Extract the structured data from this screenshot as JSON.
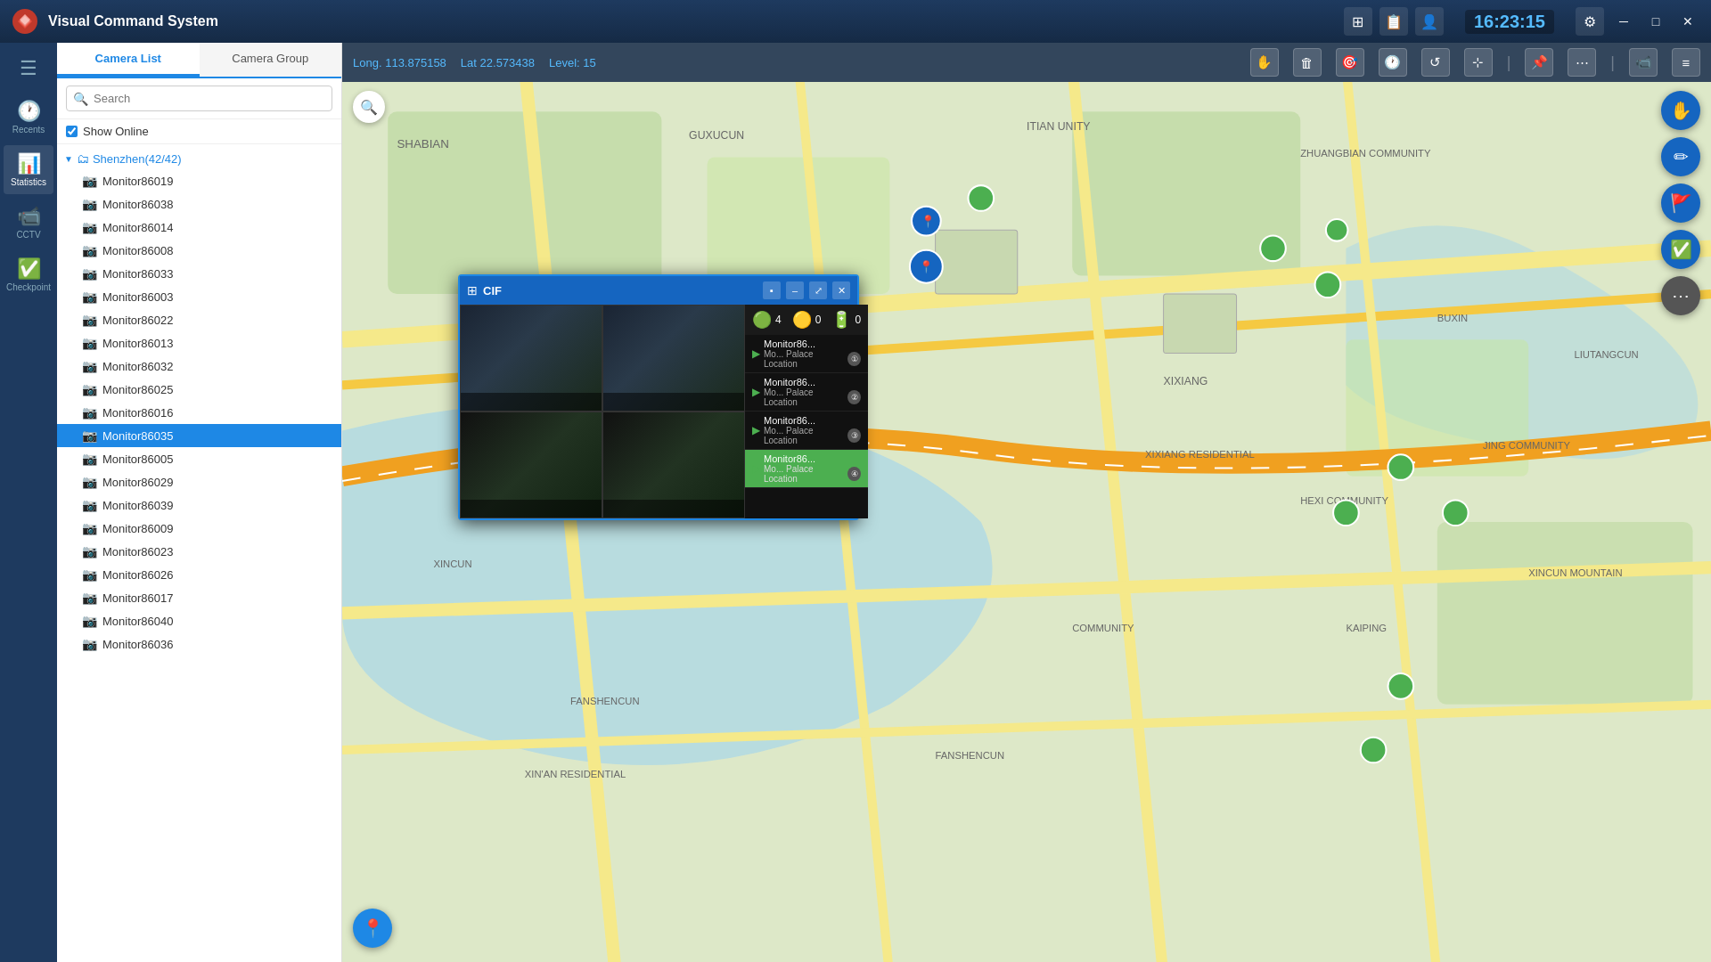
{
  "titlebar": {
    "app_title": "Visual Command System",
    "clock": "16:23:15",
    "icons": [
      "grid-icon",
      "document-icon",
      "user-icon"
    ],
    "window_controls": [
      "minimize",
      "maximize",
      "close"
    ]
  },
  "sidebar": {
    "items": [
      {
        "id": "menu",
        "label": "",
        "icon": "☰"
      },
      {
        "id": "recents",
        "label": "Recents",
        "icon": "🕐"
      },
      {
        "id": "statistics",
        "label": "Statistics",
        "icon": "📊"
      },
      {
        "id": "cctv",
        "label": "CCTV",
        "icon": "📹"
      },
      {
        "id": "checkpoint",
        "label": "Checkpoint",
        "icon": "✅"
      }
    ]
  },
  "left_panel": {
    "tabs": [
      {
        "id": "camera-list",
        "label": "Camera List",
        "active": true
      },
      {
        "id": "camera-group",
        "label": "Camera Group",
        "active": false
      }
    ],
    "search": {
      "placeholder": "Search",
      "value": ""
    },
    "show_online": {
      "label": "Show Online",
      "checked": true
    },
    "tree": {
      "root": "Shenzhen(42/42)",
      "cameras": [
        "Monitor86019",
        "Monitor86038",
        "Monitor86014",
        "Monitor86008",
        "Monitor86033",
        "Monitor86003",
        "Monitor86022",
        "Monitor86013",
        "Monitor86032",
        "Monitor86025",
        "Monitor86016",
        "Monitor86035",
        "Monitor86005",
        "Monitor86029",
        "Monitor86039",
        "Monitor86009",
        "Monitor86023",
        "Monitor86026",
        "Monitor86017",
        "Monitor86040",
        "Monitor86036"
      ],
      "selected": "Monitor86035"
    }
  },
  "map": {
    "coords": {
      "lon_label": "Long.",
      "lon_value": "113.875158",
      "lat_label": "Lat",
      "lat_value": "22.573438",
      "level_label": "Level:",
      "level_value": "15"
    },
    "toolbar_icons": [
      "hand",
      "trash",
      "target",
      "clock",
      "refresh",
      "select",
      "pin",
      "more"
    ],
    "search_btn": "🔍",
    "bottom_btn": "📍"
  },
  "cif_popup": {
    "title": "CIF",
    "title_icon": "⊞",
    "win_btns": [
      "–",
      "□",
      "⤢",
      "✕"
    ],
    "stats": [
      {
        "icon": "🟢",
        "value": "4"
      },
      {
        "icon": "🟡",
        "value": "0"
      },
      {
        "icon": "🔋",
        "value": "0"
      }
    ],
    "list_items": [
      {
        "name": "Monitor86...",
        "location": "Palace Location",
        "num": "①",
        "selected": false
      },
      {
        "name": "Monitor86...",
        "location": "Palace Location",
        "num": "②",
        "selected": false
      },
      {
        "name": "Monitor86...",
        "location": "Palace Location",
        "num": "③",
        "selected": false
      },
      {
        "name": "Monitor86...",
        "location": "Palace Location",
        "num": "④",
        "selected": true
      }
    ]
  },
  "right_btns": [
    {
      "icon": "✋",
      "bg": "#1565c0",
      "color": "#fff"
    },
    {
      "icon": "✏️",
      "bg": "#1565c0",
      "color": "#fff"
    },
    {
      "icon": "🚩",
      "bg": "#1565c0",
      "color": "#fff"
    },
    {
      "icon": "✅",
      "bg": "#1565c0",
      "color": "#fff"
    },
    {
      "icon": "⋯",
      "bg": "#555",
      "color": "#fff"
    }
  ]
}
